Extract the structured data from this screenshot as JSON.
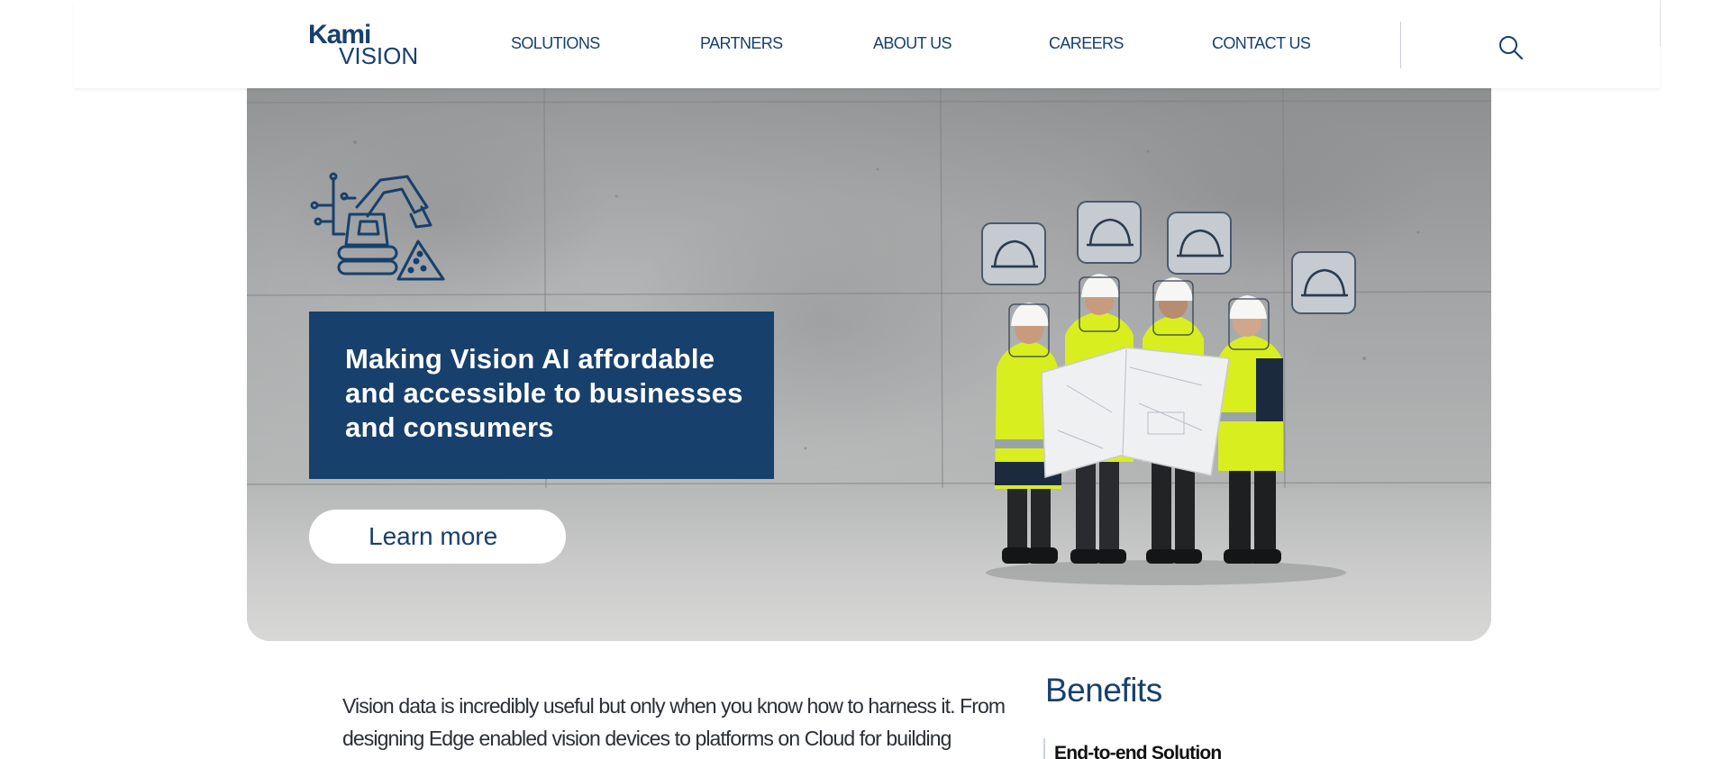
{
  "header": {
    "logo": {
      "line1": "Kami",
      "line2": "VISION"
    },
    "nav": [
      {
        "label": "SOLUTIONS"
      },
      {
        "label": "PARTNERS"
      },
      {
        "label": "ABOUT US"
      },
      {
        "label": "CAREERS"
      },
      {
        "label": "CONTACT US"
      }
    ],
    "search_icon": "search-icon"
  },
  "hero": {
    "icon": "excavator-ai-icon",
    "tagline": "Making Vision AI affordable and accessible to businesses and consumers",
    "cta_label": "Learn more",
    "image": "construction-workers-with-hardhat-icons"
  },
  "content": {
    "intro_line1": "Vision data is incredibly useful but only when you know how to harness it. From",
    "intro_line2": "designing Edge enabled vision devices to platforms on Cloud for building",
    "benefits_title": "Benefits",
    "benefits": [
      {
        "label": "End-to-end Solution"
      }
    ]
  },
  "colors": {
    "brand": "#17406d",
    "hi_vis": "#d8ee1e",
    "concrete": "#a4a6a7"
  }
}
